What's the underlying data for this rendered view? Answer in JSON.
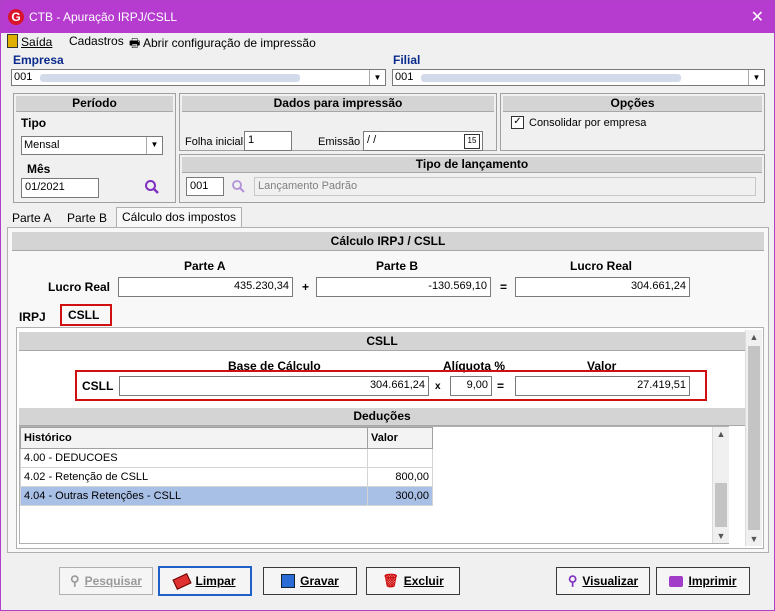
{
  "window": {
    "title": "CTB - Apuração IRPJ/CSLL",
    "close": "✕"
  },
  "menu": {
    "exit": "Saída",
    "registers": "Cadastros",
    "print_config": "Abrir configuração de impressão"
  },
  "company": {
    "label": "Empresa",
    "code": "001"
  },
  "branch": {
    "label": "Filial",
    "code": "001"
  },
  "period": {
    "header": "Período",
    "type_label": "Tipo",
    "type_value": "Mensal",
    "month_label": "Mês",
    "month_value": "01/2021"
  },
  "print_data": {
    "header": "Dados para impressão",
    "initial_sheet_label": "Folha inicial",
    "initial_sheet_value": "1",
    "issue_label": "Emissão",
    "issue_value": " / /",
    "calendar_text": "15"
  },
  "options": {
    "header": "Opções",
    "consolidate_label": "Consolidar por empresa",
    "consolidate_checked": true
  },
  "entry_type": {
    "header": "Tipo de lançamento",
    "code": "001",
    "description": "Lançamento Padrão"
  },
  "outer_tabs": [
    "Parte A",
    "Parte B",
    "Cálculo dos impostos"
  ],
  "calc": {
    "header": "Cálculo IRPJ / CSLL",
    "col_a": "Parte A",
    "col_b": "Parte B",
    "col_real": "Lucro Real",
    "row_label": "Lucro Real",
    "part_a": "435.230,34",
    "plus": "+",
    "part_b": "-130.569,10",
    "equals": "=",
    "real_profit": "304.661,24"
  },
  "inner_tabs": [
    "IRPJ",
    "CSLL"
  ],
  "csll": {
    "header": "CSLL",
    "base_label": "Base de Cálculo",
    "rate_label": "Alíquota %",
    "value_label": "Valor",
    "row_label": "CSLL",
    "base": "304.661,24",
    "times": "x",
    "rate": "9,00",
    "equals": "=",
    "value": "27.419,51"
  },
  "deductions": {
    "header": "Deduções",
    "columns": [
      "Histórico",
      "Valor"
    ],
    "rows": [
      {
        "history": "4.00 - DEDUCOES",
        "value": ""
      },
      {
        "history": "4.02 - Retenção de CSLL",
        "value": "800,00"
      },
      {
        "history": "4.04 - Outras Retenções - CSLL",
        "value": "300,00"
      }
    ]
  },
  "buttons": {
    "search": "Pesquisar",
    "clear": "Limpar",
    "save": "Gravar",
    "delete": "Excluir",
    "view": "Visualizar",
    "print": "Imprimir"
  },
  "colors": {
    "titlebar": "#b63ccf",
    "label_blue": "#0a2a8c",
    "highlight_red": "#d01010",
    "selected_row": "#a8bfe6"
  }
}
